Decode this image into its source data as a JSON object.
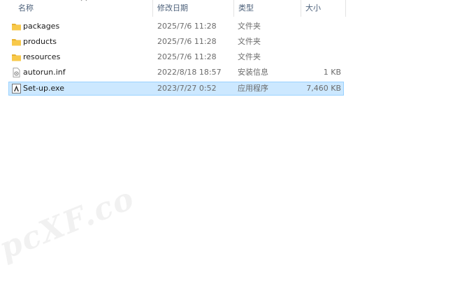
{
  "columns": {
    "name": "名称",
    "date": "修改日期",
    "type": "类型",
    "size": "大小"
  },
  "files": [
    {
      "name": "packages",
      "date": "2025/7/6 11:28",
      "type": "文件夹",
      "size": "",
      "icon": "folder-icon",
      "selected": false
    },
    {
      "name": "products",
      "date": "2025/7/6 11:28",
      "type": "文件夹",
      "size": "",
      "icon": "folder-icon",
      "selected": false
    },
    {
      "name": "resources",
      "date": "2025/7/6 11:28",
      "type": "文件夹",
      "size": "",
      "icon": "folder-icon",
      "selected": false
    },
    {
      "name": "autorun.inf",
      "date": "2022/8/18 18:57",
      "type": "安装信息",
      "size": "1 KB",
      "icon": "inf-file-icon",
      "selected": false
    },
    {
      "name": "Set-up.exe",
      "date": "2023/7/27 0:52",
      "type": "应用程序",
      "size": "7,460 KB",
      "icon": "adobe-app-icon",
      "selected": true
    }
  ],
  "watermark": "pcXF.co",
  "colors": {
    "selection_bg": "#cce8ff",
    "selection_border": "#99d1ff",
    "folder": "#f8c94a",
    "header_text": "#4c607a"
  }
}
